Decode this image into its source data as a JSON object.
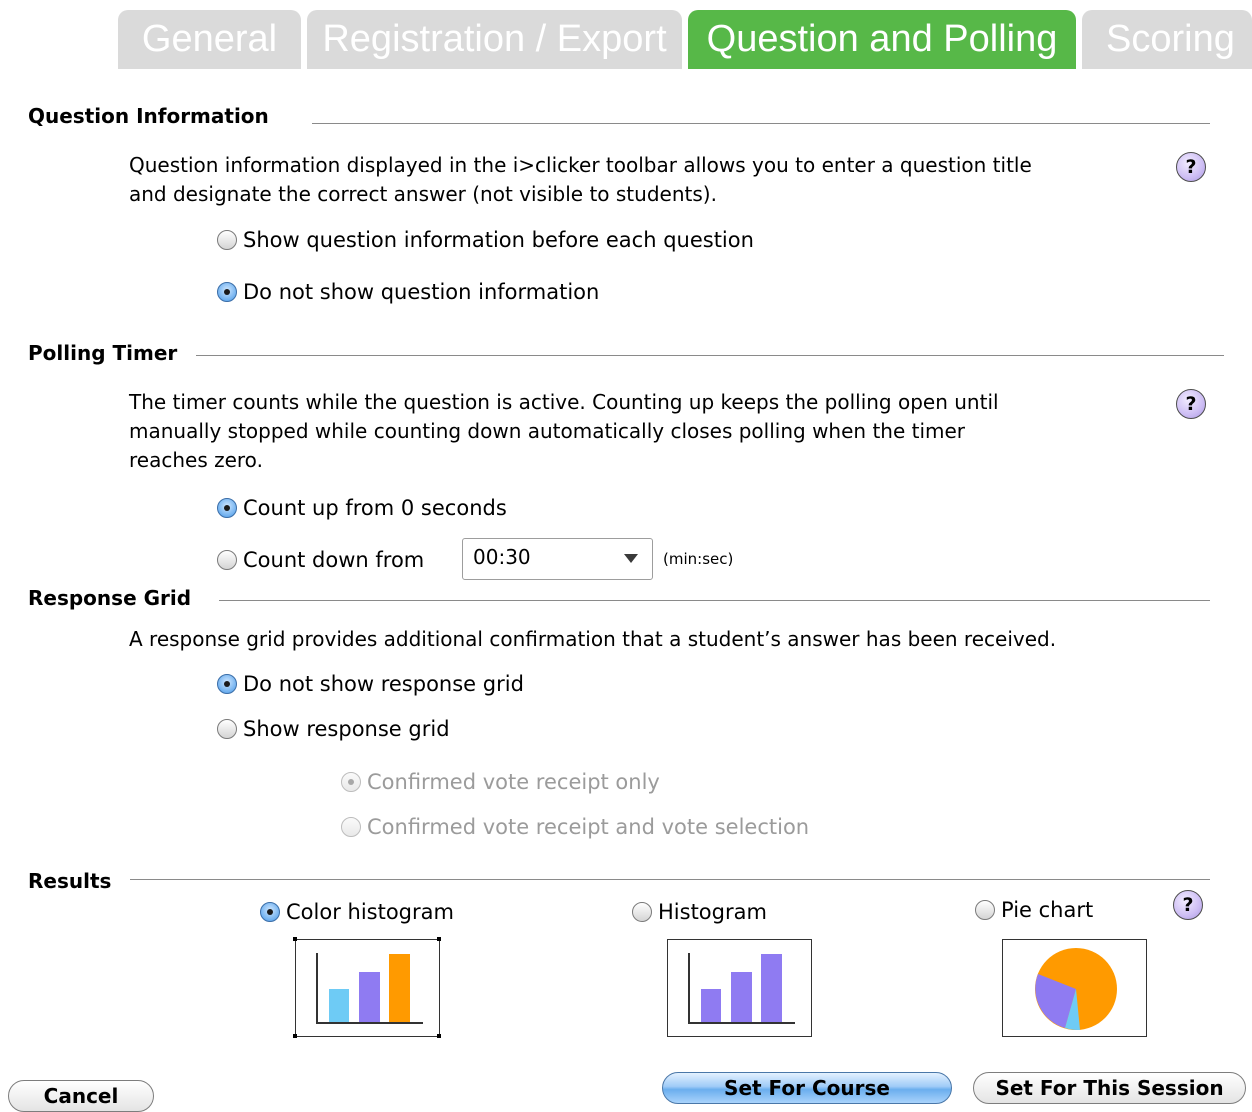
{
  "tabs": [
    {
      "label": "General",
      "active": false
    },
    {
      "label": "Registration / Export",
      "active": false
    },
    {
      "label": "Question and Polling",
      "active": true
    },
    {
      "label": "Scoring",
      "active": false
    }
  ],
  "question_info": {
    "title": "Question Information",
    "description_line1": "Question information displayed in the i>clicker toolbar allows you to enter a question title",
    "description_line2": "and designate the correct answer (not visible to students).",
    "options": [
      {
        "label": "Show question information before each question",
        "selected": false
      },
      {
        "label": "Do not show question information",
        "selected": true
      }
    ]
  },
  "polling_timer": {
    "title": "Polling Timer",
    "description_line1": "The timer counts while the question is active. Counting up keeps the polling open until",
    "description_line2": "manually stopped while counting down automatically closes polling when the timer",
    "description_line3": "reaches zero.",
    "count_up_label": "Count up from 0 seconds",
    "count_up_selected": true,
    "count_down_label": "Count down from",
    "count_down_selected": false,
    "countdown_value": "00:30",
    "unit_label": "(min:sec)"
  },
  "response_grid": {
    "title": "Response Grid",
    "description": "A response grid provides additional confirmation that a student’s answer has been received.",
    "options": [
      {
        "label": "Do not show response grid",
        "selected": true
      },
      {
        "label": "Show response grid",
        "selected": false
      }
    ],
    "sub_options": [
      {
        "label": "Confirmed vote receipt only",
        "selected": true,
        "disabled": true
      },
      {
        "label": "Confirmed vote receipt and vote selection",
        "selected": false,
        "disabled": true
      }
    ]
  },
  "results": {
    "title": "Results",
    "options": [
      {
        "label": "Color histogram",
        "selected": true
      },
      {
        "label": "Histogram",
        "selected": false
      },
      {
        "label": "Pie chart",
        "selected": false
      }
    ]
  },
  "help_icon_text": "?",
  "buttons": {
    "cancel": "Cancel",
    "set_for_course": "Set For Course",
    "set_for_session": "Set For This Session"
  },
  "colors": {
    "active_tab": "#57b848",
    "inactive_tab": "#dadada",
    "bar_blue": "#6ecbf5",
    "bar_purple": "#8f7bf2",
    "bar_orange": "#ff9a00"
  }
}
